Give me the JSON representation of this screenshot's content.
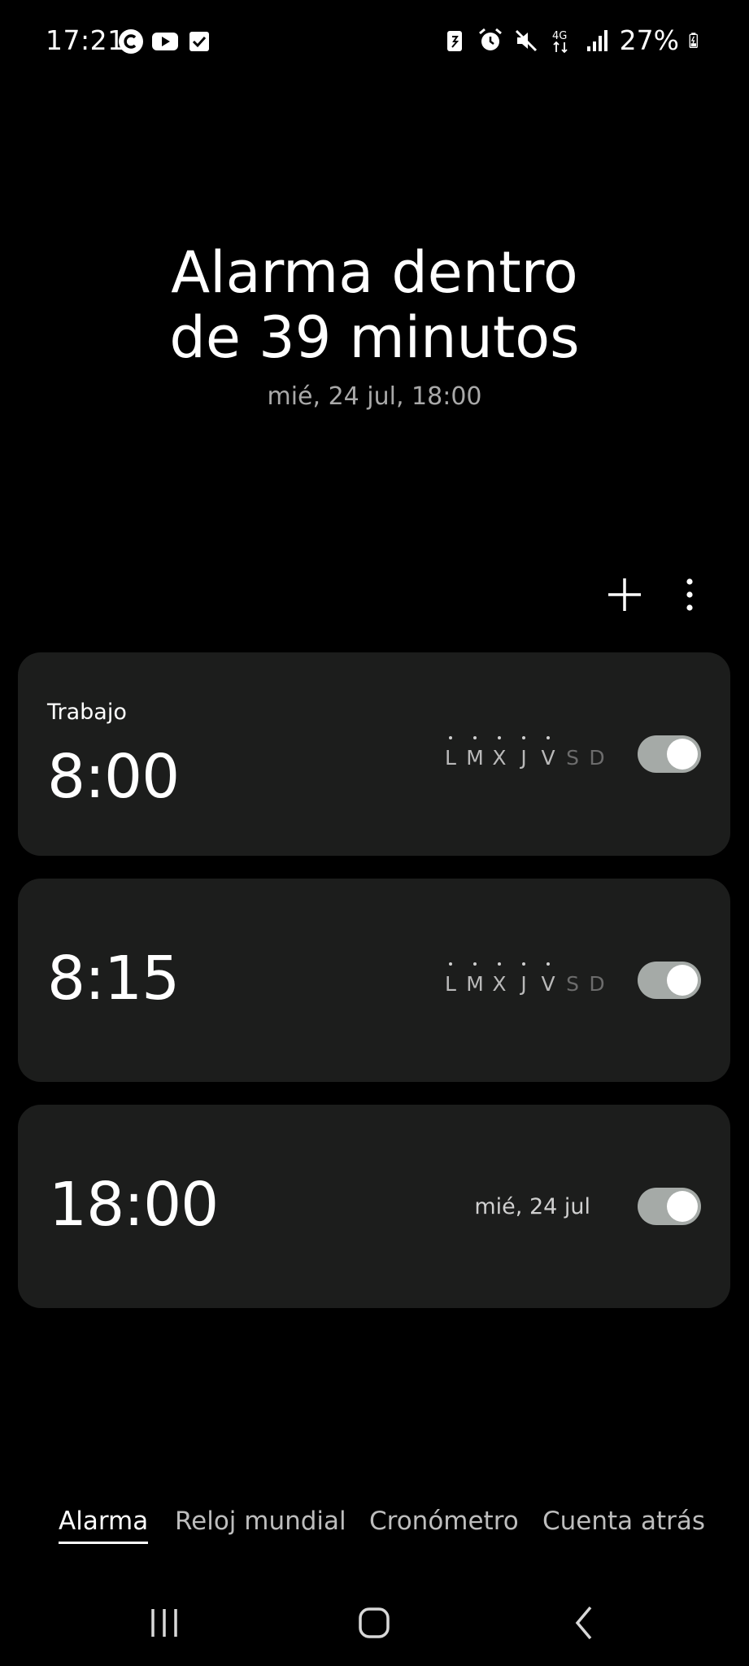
{
  "status_bar": {
    "time": "17:21",
    "left_icons": [
      "c-circle-icon",
      "youtube-icon",
      "check-box-icon"
    ],
    "right_icons": [
      "battery-saver-icon",
      "alarm-clock-icon",
      "mute-icon",
      "network-4g-icon",
      "signal-icon"
    ],
    "network_label": "4G",
    "battery_percent": "27%"
  },
  "header": {
    "headline_line1": "Alarma dentro",
    "headline_line2": "de 39 minutos",
    "next_alarm": "mié, 24 jul, 18:00"
  },
  "toolbar": {
    "add_icon": "plus-icon",
    "more_icon": "more-vert-icon"
  },
  "alarms": [
    {
      "label": "Trabajo",
      "time": "8:00",
      "days": [
        {
          "letter": "L",
          "active": true
        },
        {
          "letter": "M",
          "active": true
        },
        {
          "letter": "X",
          "active": true
        },
        {
          "letter": "J",
          "active": true
        },
        {
          "letter": "V",
          "active": true
        },
        {
          "letter": "S",
          "active": false
        },
        {
          "letter": "D",
          "active": false
        }
      ],
      "enabled": true
    },
    {
      "label": "",
      "time": "8:15",
      "days": [
        {
          "letter": "L",
          "active": true
        },
        {
          "letter": "M",
          "active": true
        },
        {
          "letter": "X",
          "active": true
        },
        {
          "letter": "J",
          "active": true
        },
        {
          "letter": "V",
          "active": true
        },
        {
          "letter": "S",
          "active": false
        },
        {
          "letter": "D",
          "active": false
        }
      ],
      "enabled": true
    },
    {
      "label": "",
      "time": "18:00",
      "date": "mié, 24 jul",
      "enabled": true
    }
  ],
  "tabs": [
    {
      "label": "Alarma",
      "active": true
    },
    {
      "label": "Reloj mundial",
      "active": false
    },
    {
      "label": "Cronómetro",
      "active": false
    },
    {
      "label": "Cuenta atrás",
      "active": false
    }
  ],
  "nav": [
    "recents-icon",
    "home-icon",
    "back-icon"
  ],
  "colors": {
    "background": "#000000",
    "card": "#1c1d1c",
    "toggle_on": "#a5aaa7",
    "muted_text": "#a9a9a9"
  }
}
